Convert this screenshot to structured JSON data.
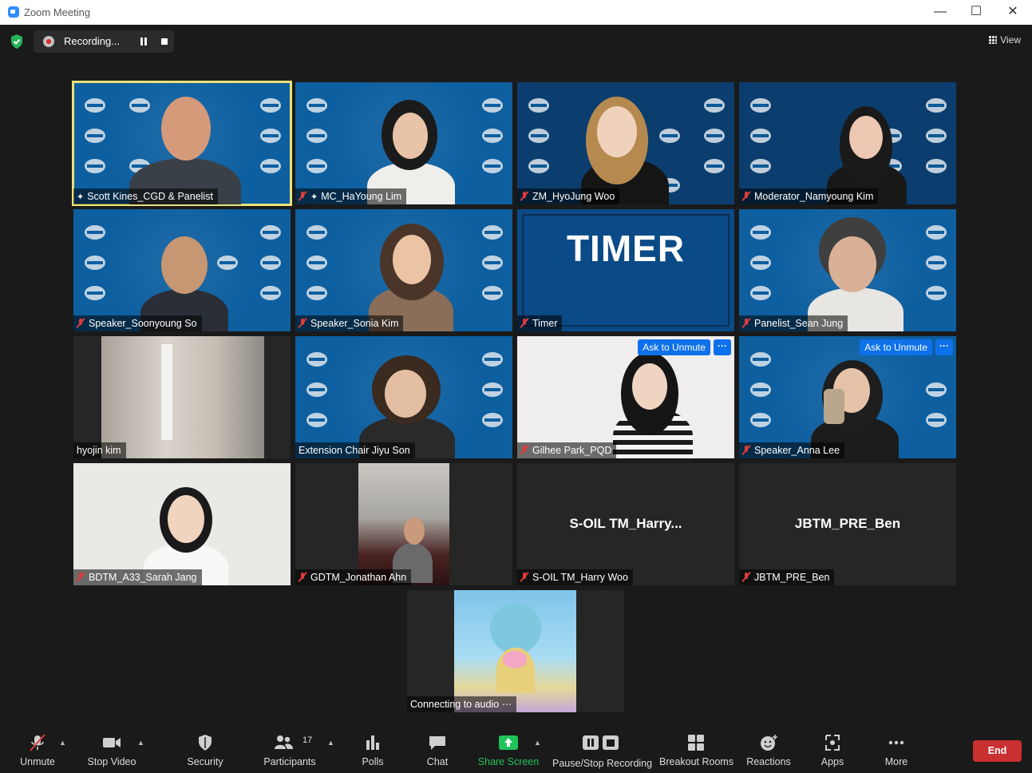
{
  "window": {
    "title": "Zoom Meeting",
    "minimize": "—",
    "maximize": "☐",
    "close": "✕"
  },
  "topbar": {
    "recording_label": "Recording...",
    "view_label": "View"
  },
  "tiles": [
    {
      "name": "Scott Kines_CGD & Panelist",
      "muted": false,
      "pinned": true
    },
    {
      "name": "MC_HaYoung Lim",
      "muted": true,
      "pinned": true
    },
    {
      "name": "ZM_HyoJung Woo",
      "muted": true
    },
    {
      "name": "Moderator_Namyoung Kim",
      "muted": true
    },
    {
      "name": "Speaker_Soonyoung So",
      "muted": true
    },
    {
      "name": "Speaker_Sonia Kim",
      "muted": true
    },
    {
      "name": "Timer",
      "muted": true,
      "display_text": "TIMER"
    },
    {
      "name": "Panelist_Sean Jung",
      "muted": true
    },
    {
      "name": "hyojin kim",
      "muted": false
    },
    {
      "name": "Extension Chair Jiyu Son",
      "muted": false
    },
    {
      "name": "Gilhee Park_PQD",
      "muted": true,
      "ask_to_unmute": "Ask to Unmute"
    },
    {
      "name": "Speaker_Anna Lee",
      "muted": true,
      "ask_to_unmute": "Ask to Unmute"
    },
    {
      "name": "BDTM_A33_Sarah Jang",
      "muted": true
    },
    {
      "name": "GDTM_Jonathan Ahn",
      "muted": true
    },
    {
      "name": "S-OIL TM_Harry Woo",
      "muted": true,
      "center_text": "S-OIL  TM_Harry..."
    },
    {
      "name": "JBTM_PRE_Ben",
      "muted": true,
      "center_text": "JBTM_PRE_Ben"
    },
    {
      "name": "Connecting to audio",
      "muted": false
    }
  ],
  "toolbar": {
    "unmute": "Unmute",
    "stop_video": "Stop Video",
    "security": "Security",
    "participants": "Participants",
    "participants_count": "17",
    "polls": "Polls",
    "chat": "Chat",
    "share_screen": "Share Screen",
    "pause_stop_recording": "Pause/Stop Recording",
    "breakout_rooms": "Breakout Rooms",
    "reactions": "Reactions",
    "apps": "Apps",
    "more": "More",
    "end": "End"
  },
  "colors": {
    "active_speaker_border": "#e9e27a",
    "tile_blue": "#0d5fa0",
    "share_green": "#21c45a",
    "end_red": "#c93030",
    "ask_blue": "#0e71eb",
    "muted_red": "#e03b3b"
  }
}
